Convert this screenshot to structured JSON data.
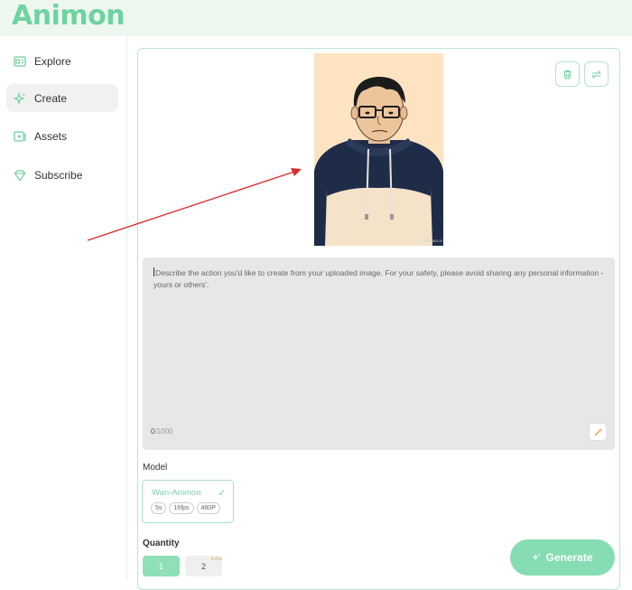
{
  "app": {
    "logo": "Animon"
  },
  "sidebar": {
    "items": [
      {
        "label": "Explore",
        "icon": "explore-icon"
      },
      {
        "label": "Create",
        "icon": "sparkle-icon",
        "active": true
      },
      {
        "label": "Assets",
        "icon": "assets-icon"
      },
      {
        "label": "Subscribe",
        "icon": "diamond-icon"
      }
    ]
  },
  "image": {
    "watermark": "animon.ai"
  },
  "prompt": {
    "placeholder": "Describe the action you'd like to create from your uploaded image. For your safety, please avoid sharing any personal information - yours or others'.",
    "count": "0",
    "max": "/1000"
  },
  "model": {
    "label": "Model",
    "name": "Wan-Animon",
    "tags": [
      "5s",
      "16fps",
      "480P"
    ]
  },
  "quantity": {
    "label": "Quantity",
    "options": [
      "1",
      "2"
    ],
    "selected": "1",
    "badge": "Extra"
  },
  "generate": {
    "label": "Generate"
  },
  "colors": {
    "accent": "#6dd3a0",
    "topbar_bg": "#eef7ef",
    "prompt_bg": "#e7e7e7",
    "annotation_arrow": "#d62f2f"
  }
}
